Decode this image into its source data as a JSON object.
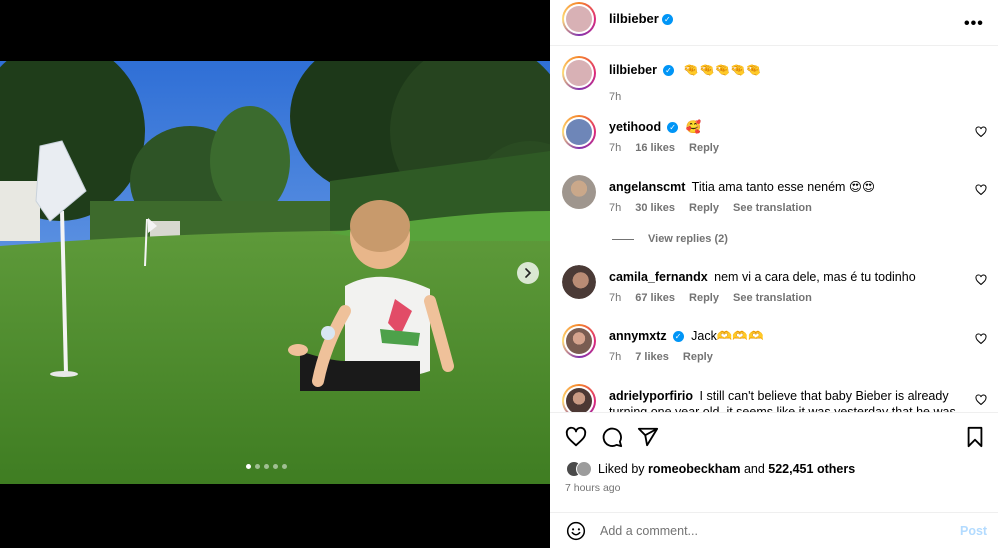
{
  "post": {
    "author": "lilbieber",
    "caption_emojis": "🤏🤏🤏🤏🤏",
    "caption_time": "7h",
    "more_icon": "more-options-icon",
    "carousel": {
      "count": 5,
      "active_index": 0
    }
  },
  "comments": [
    {
      "user": "yetihood",
      "verified": true,
      "text": "🥰",
      "time": "7h",
      "likes": "16 likes",
      "reply": "Reply",
      "translation": ""
    },
    {
      "user": "angelanscmt",
      "verified": false,
      "text": "Titia ama tanto esse neném 😍😍",
      "time": "7h",
      "likes": "30 likes",
      "reply": "Reply",
      "translation": "See translation"
    },
    {
      "user": "camila_fernandx",
      "verified": false,
      "text": "nem vi a cara dele, mas é tu todinho",
      "time": "7h",
      "likes": "67 likes",
      "reply": "Reply",
      "translation": "See translation"
    },
    {
      "user": "annymxtz",
      "verified": true,
      "text": "Jack🫶🫶🫶",
      "time": "7h",
      "likes": "7 likes",
      "reply": "Reply",
      "translation": ""
    },
    {
      "user": "adrielyporfirio",
      "verified": false,
      "text": "I still can't believe that baby Bieber is already turning one year old, it seems like it was yesterday that he was",
      "time": "",
      "likes": "",
      "reply": "",
      "translation": ""
    }
  ],
  "view_replies": "View replies (2)",
  "liked_by": {
    "prefix": "Liked by",
    "user": "romeobeckham",
    "and": "and",
    "count": "522,451 others"
  },
  "posted_ago": "7 hours ago",
  "add_comment": {
    "placeholder": "Add a comment...",
    "post_label": "Post"
  },
  "colors": {
    "link": "#0095f6",
    "post_disabled": "#b3dbff",
    "muted": "#737373"
  }
}
